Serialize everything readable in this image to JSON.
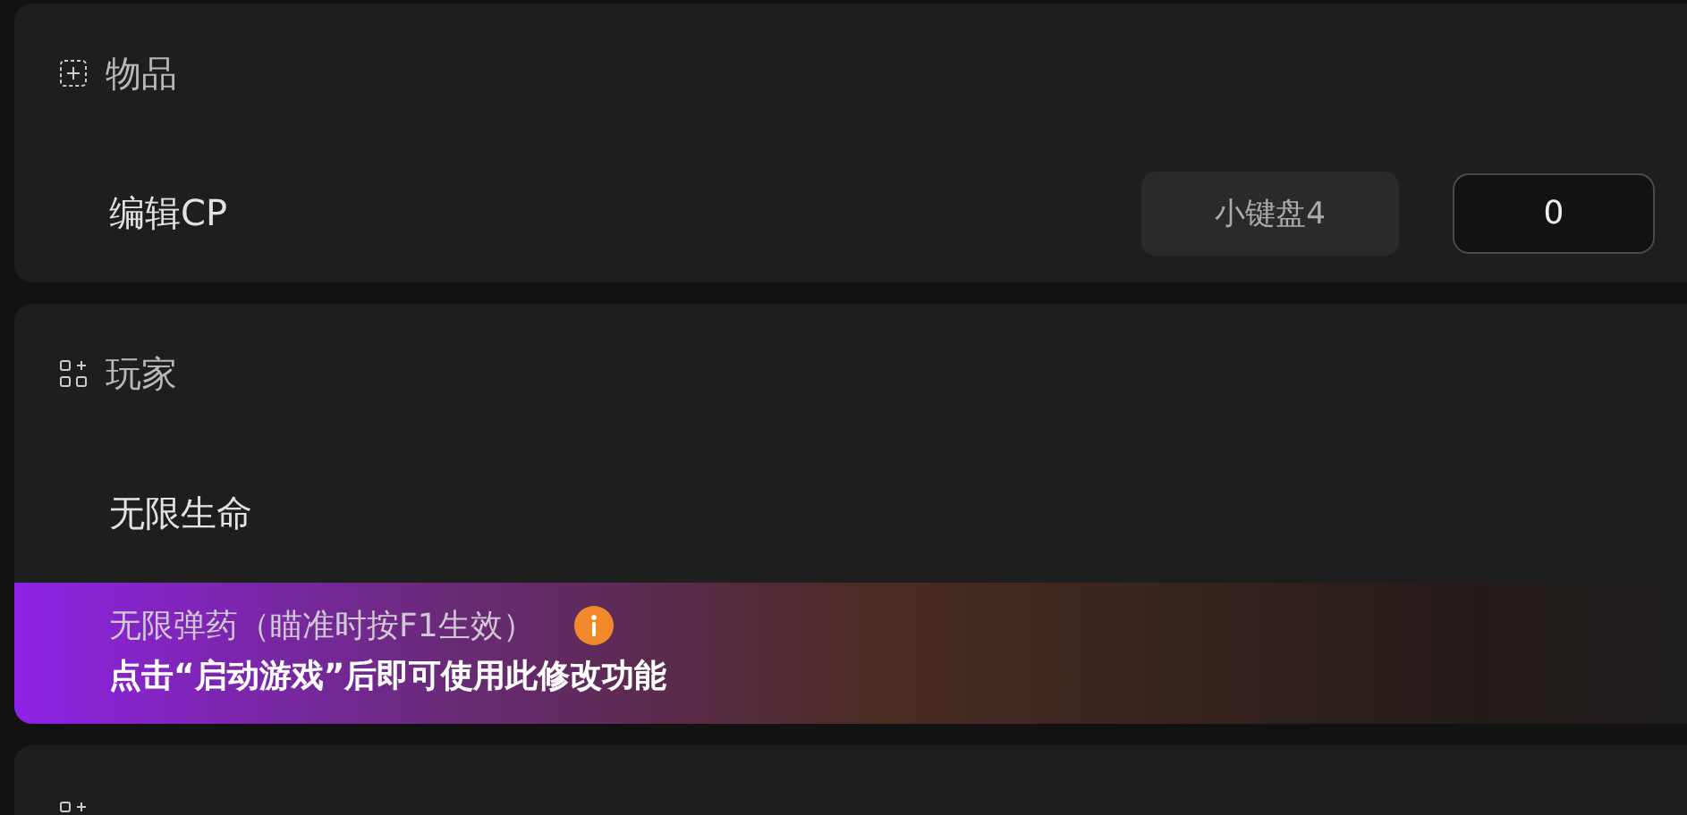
{
  "sections": [
    {
      "kind": "items",
      "title": "物品",
      "items": [
        {
          "kind": "hotkey",
          "label": "编辑CP",
          "hotkey": "小键盘4",
          "value": "0"
        }
      ]
    },
    {
      "kind": "group",
      "title": "玩家",
      "items": [
        {
          "kind": "plain",
          "label": "无限生命"
        },
        {
          "kind": "locked",
          "label": "无限弹药（瞄准时按F1生效）",
          "info": true,
          "note": "点击“启动游戏”后即可使用此修改功能"
        }
      ]
    },
    {
      "kind": "group"
    }
  ]
}
